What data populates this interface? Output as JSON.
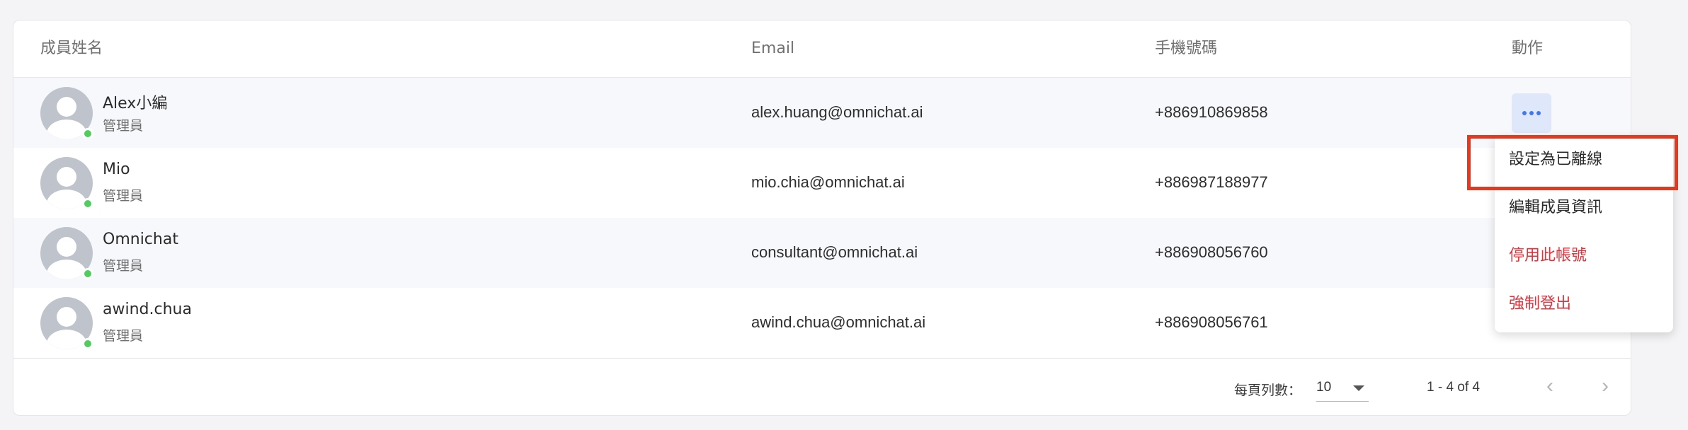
{
  "table": {
    "columns": {
      "name": "成員姓名",
      "email": "Email",
      "phone": "手機號碼",
      "action": "動作"
    },
    "rows": [
      {
        "name": "Alex小編",
        "role": "管理員",
        "email": "alex.huang@omnichat.ai",
        "phone": "+886910869858",
        "status": "online"
      },
      {
        "name": "Mio",
        "role": "管理員",
        "email": "mio.chia@omnichat.ai",
        "phone": "+886987188977",
        "status": "online"
      },
      {
        "name": "Omnichat",
        "role": "管理員",
        "email": "consultant@omnichat.ai",
        "phone": "+886908056760",
        "status": "online"
      },
      {
        "name": "awind.chua",
        "role": "管理員",
        "email": "awind.chua@omnichat.ai",
        "phone": "+886908056761",
        "status": "online"
      }
    ]
  },
  "pagination": {
    "rows_per_page_label": "每頁列數：",
    "rows_per_page_value": "10",
    "range_text": "1 - 4 of 4"
  },
  "action_menu": {
    "items": [
      {
        "label": "設定為已離線",
        "tone": "normal"
      },
      {
        "label": "編輯成員資訊",
        "tone": "normal"
      },
      {
        "label": "停用此帳號",
        "tone": "danger"
      },
      {
        "label": "強制登出",
        "tone": "danger"
      }
    ]
  },
  "icons": {
    "avatar": "default-user-avatar-icon",
    "status": "online-status-dot-icon",
    "more": "more-horizontal-icon",
    "rows_select_caret": "caret-down-icon",
    "prev": "chevron-left-icon",
    "next": "chevron-right-icon"
  },
  "colors": {
    "online_status": "#4fce5d",
    "primary": "#3f78f0",
    "danger": "#e2323b",
    "highlight": "#e03a22"
  }
}
